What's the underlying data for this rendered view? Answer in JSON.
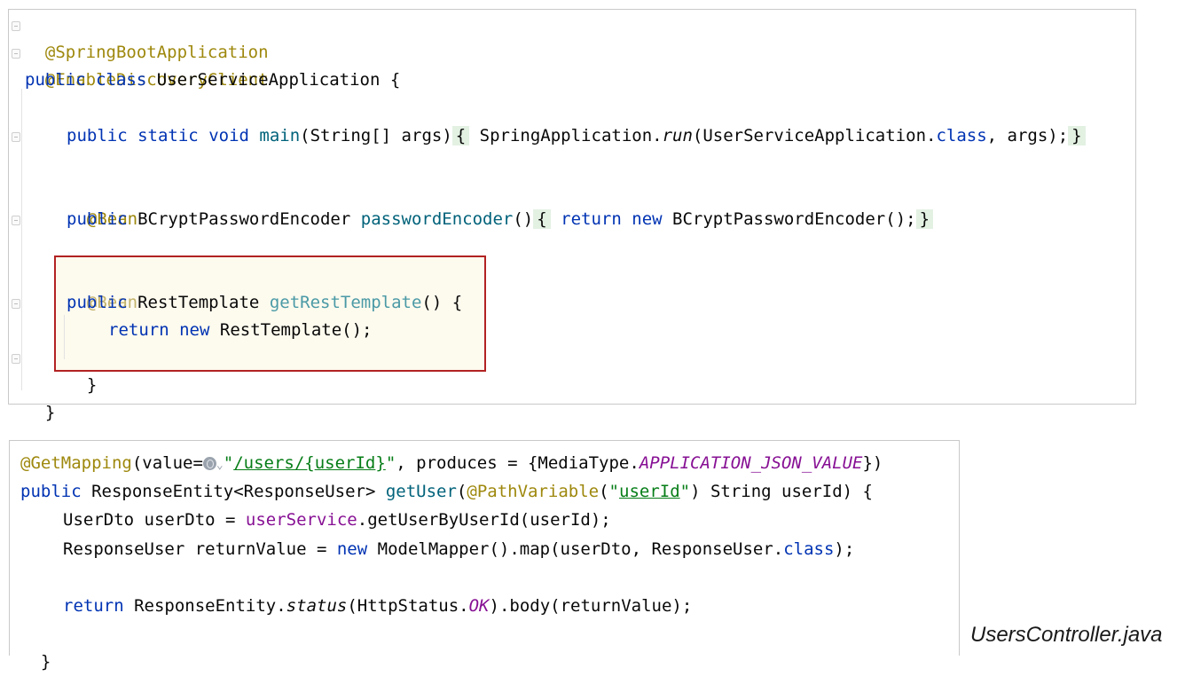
{
  "top_editor": {
    "line1_annotation": "@SpringBootApplication",
    "line2_annotation": "@EnableDiscoveryClient",
    "line3": {
      "kw1": "public",
      "kw2": "class",
      "name": "UserServiceApplication",
      "brace": "{"
    },
    "line5": {
      "kw1": "public",
      "kw2": "static",
      "kw3": "void",
      "fn": "main",
      "params": "(String[] args)",
      "open": "{",
      "call_pre": "SpringApplication.",
      "call_method": "run",
      "call_arg_pre": "(UserServiceApplication.",
      "call_arg_kw": "class",
      "call_arg_post": ", args);",
      "close": "}"
    },
    "line7_annotation": "@Bean",
    "line8": {
      "kw1": "public",
      "type": "BCryptPasswordEncoder",
      "fn": "passwordEncoder",
      "parens": "()",
      "open": "{",
      "kw_return": "return",
      "kw_new": "new",
      "ctor": "BCryptPasswordEncoder();",
      "close": "}"
    },
    "highlighted_block": {
      "annotation": "@Bean",
      "kw1": "public",
      "type": "RestTemplate",
      "fn": "getRestTemplate",
      "sig_rest": "() {",
      "kw_return": "return",
      "kw_new": "new",
      "ctor": "RestTemplate();",
      "close": "}"
    },
    "class_close": "}"
  },
  "bottom_editor": {
    "line1": {
      "annotation": "@GetMapping",
      "pre": "(value=",
      "str_quote_open": "\"",
      "str_path_pre": "/users/{",
      "str_path_var": "userId",
      "str_path_post": "}",
      "str_quote_close": "\"",
      "post": ", produces = {MediaType.",
      "const": "APPLICATION_JSON_VALUE",
      "end": "})"
    },
    "line2": {
      "kw1": "public",
      "type": "ResponseEntity<ResponseUser>",
      "fn": "getUser",
      "paren": "(",
      "annotation": "@PathVariable",
      "arg_paren": "(",
      "str_open": "\"",
      "str_val": "userId",
      "str_close": "\"",
      "rest": ") String userId) {"
    },
    "line3": {
      "pre": "UserDto userDto = ",
      "field": "userService",
      "post": ".getUserByUserId(userId);"
    },
    "line4": {
      "pre": "ResponseUser returnValue = ",
      "kw_new": "new",
      "mid": "ModelMapper().map(userDto, ResponseUser.",
      "kw_class": "class",
      "end": ");"
    },
    "line6": {
      "kw_return": "return",
      "pre": "ResponseEntity.",
      "method": "status",
      "arg_pre": "(HttpStatus.",
      "const": "OK",
      "end": ").body(returnValue);"
    },
    "close": "}"
  },
  "caption": "UsersController.java",
  "colors": {
    "keyword": "#0033b3",
    "annotation": "#9e880d",
    "function": "#00627a",
    "string": "#067d17",
    "constant": "#871094",
    "highlight_border": "#b22222"
  }
}
